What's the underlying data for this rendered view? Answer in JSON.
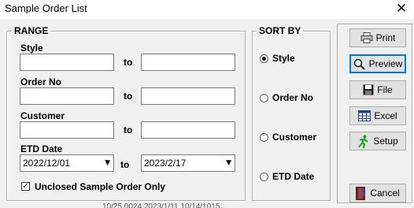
{
  "window": {
    "title": "Sample Order List"
  },
  "range": {
    "title": "RANGE",
    "style": {
      "label": "Style",
      "from": "",
      "to": ""
    },
    "order_no": {
      "label": "Order No",
      "from": "",
      "to": ""
    },
    "customer": {
      "label": "Customer",
      "from": "",
      "to": ""
    },
    "etd_date": {
      "label": "ETD Date",
      "from": "2022/12/01",
      "to": "2023/2/17"
    },
    "to_label": "to",
    "unclosed": {
      "label": "Unclosed Sample Order Only",
      "checked": true
    }
  },
  "sort_by": {
    "title": "SORT BY",
    "options": [
      "Style",
      "Order No",
      "Customer",
      "ETD Date"
    ],
    "selected": "Style"
  },
  "buttons": {
    "print": "Print",
    "preview": "Preview",
    "file": "File",
    "excel": "Excel",
    "setup": "Setup",
    "cancel": "Cancel"
  },
  "icons": {
    "close": "close-icon",
    "print": "printer-icon",
    "preview": "magnifier-icon",
    "file": "floppy-disk-icon",
    "excel": "excel-icon",
    "setup": "running-man-icon",
    "cancel": "door-exit-icon"
  },
  "background_partial_text": "10/25 0024    2023/1/11    10/14/1015    ..."
}
